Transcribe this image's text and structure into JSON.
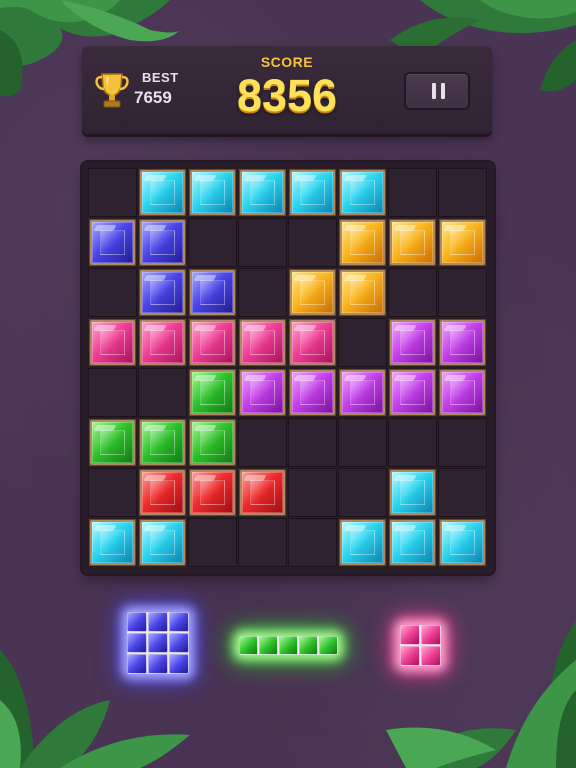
{
  "header": {
    "best_label": "BEST",
    "best_value": "7659",
    "score_label": "SCORE",
    "score_value": "8356"
  },
  "colors": {
    "cyan": {
      "l": "#b6fbff",
      "c": "#2bd5f0",
      "d": "#0a84b0"
    },
    "blue": {
      "l": "#a7a8ff",
      "c": "#4b45e8",
      "d": "#231c92"
    },
    "yellow": {
      "l": "#ffe58a",
      "c": "#fbb51c",
      "d": "#c96d04"
    },
    "pink": {
      "l": "#ffa4cf",
      "c": "#ef3e95",
      "d": "#a8125a"
    },
    "purple": {
      "l": "#f0a4ff",
      "c": "#c440ea",
      "d": "#7b129e"
    },
    "green": {
      "l": "#a8f794",
      "c": "#2fc22c",
      "d": "#117a14"
    },
    "red": {
      "l": "#ffa0a0",
      "c": "#ee2b2b",
      "d": "#a10c12"
    }
  },
  "board": {
    "rows": [
      [
        ".",
        "cyan",
        "cyan",
        "cyan",
        "cyan",
        "cyan",
        ".",
        "."
      ],
      [
        "blue",
        "blue",
        ".",
        ".",
        ".",
        "yellow",
        "yellow",
        "yellow"
      ],
      [
        ".",
        "blue",
        "blue",
        ".",
        "yellow",
        "yellow",
        ".",
        "."
      ],
      [
        "pink",
        "pink",
        "pink",
        "pink",
        "pink",
        ".",
        "purple",
        "purple"
      ],
      [
        ".",
        ".",
        "green",
        "purple",
        "purple",
        "purple",
        "purple",
        "purple"
      ],
      [
        "green",
        "green",
        "green",
        ".",
        ".",
        ".",
        ".",
        "."
      ],
      [
        ".",
        "red",
        "red",
        "red",
        ".",
        ".",
        "cyan",
        "."
      ],
      [
        "cyan",
        "cyan",
        ".",
        ".",
        ".",
        "cyan",
        "cyan",
        "cyan"
      ]
    ]
  },
  "tray": [
    {
      "name": "tray-piece-blue-square",
      "color": "blue",
      "cols": 3,
      "rows": 3
    },
    {
      "name": "tray-piece-green-line",
      "color": "green",
      "cols": 5,
      "rows": 1
    },
    {
      "name": "tray-piece-pink-square",
      "color": "pink",
      "cols": 2,
      "rows": 2
    }
  ]
}
